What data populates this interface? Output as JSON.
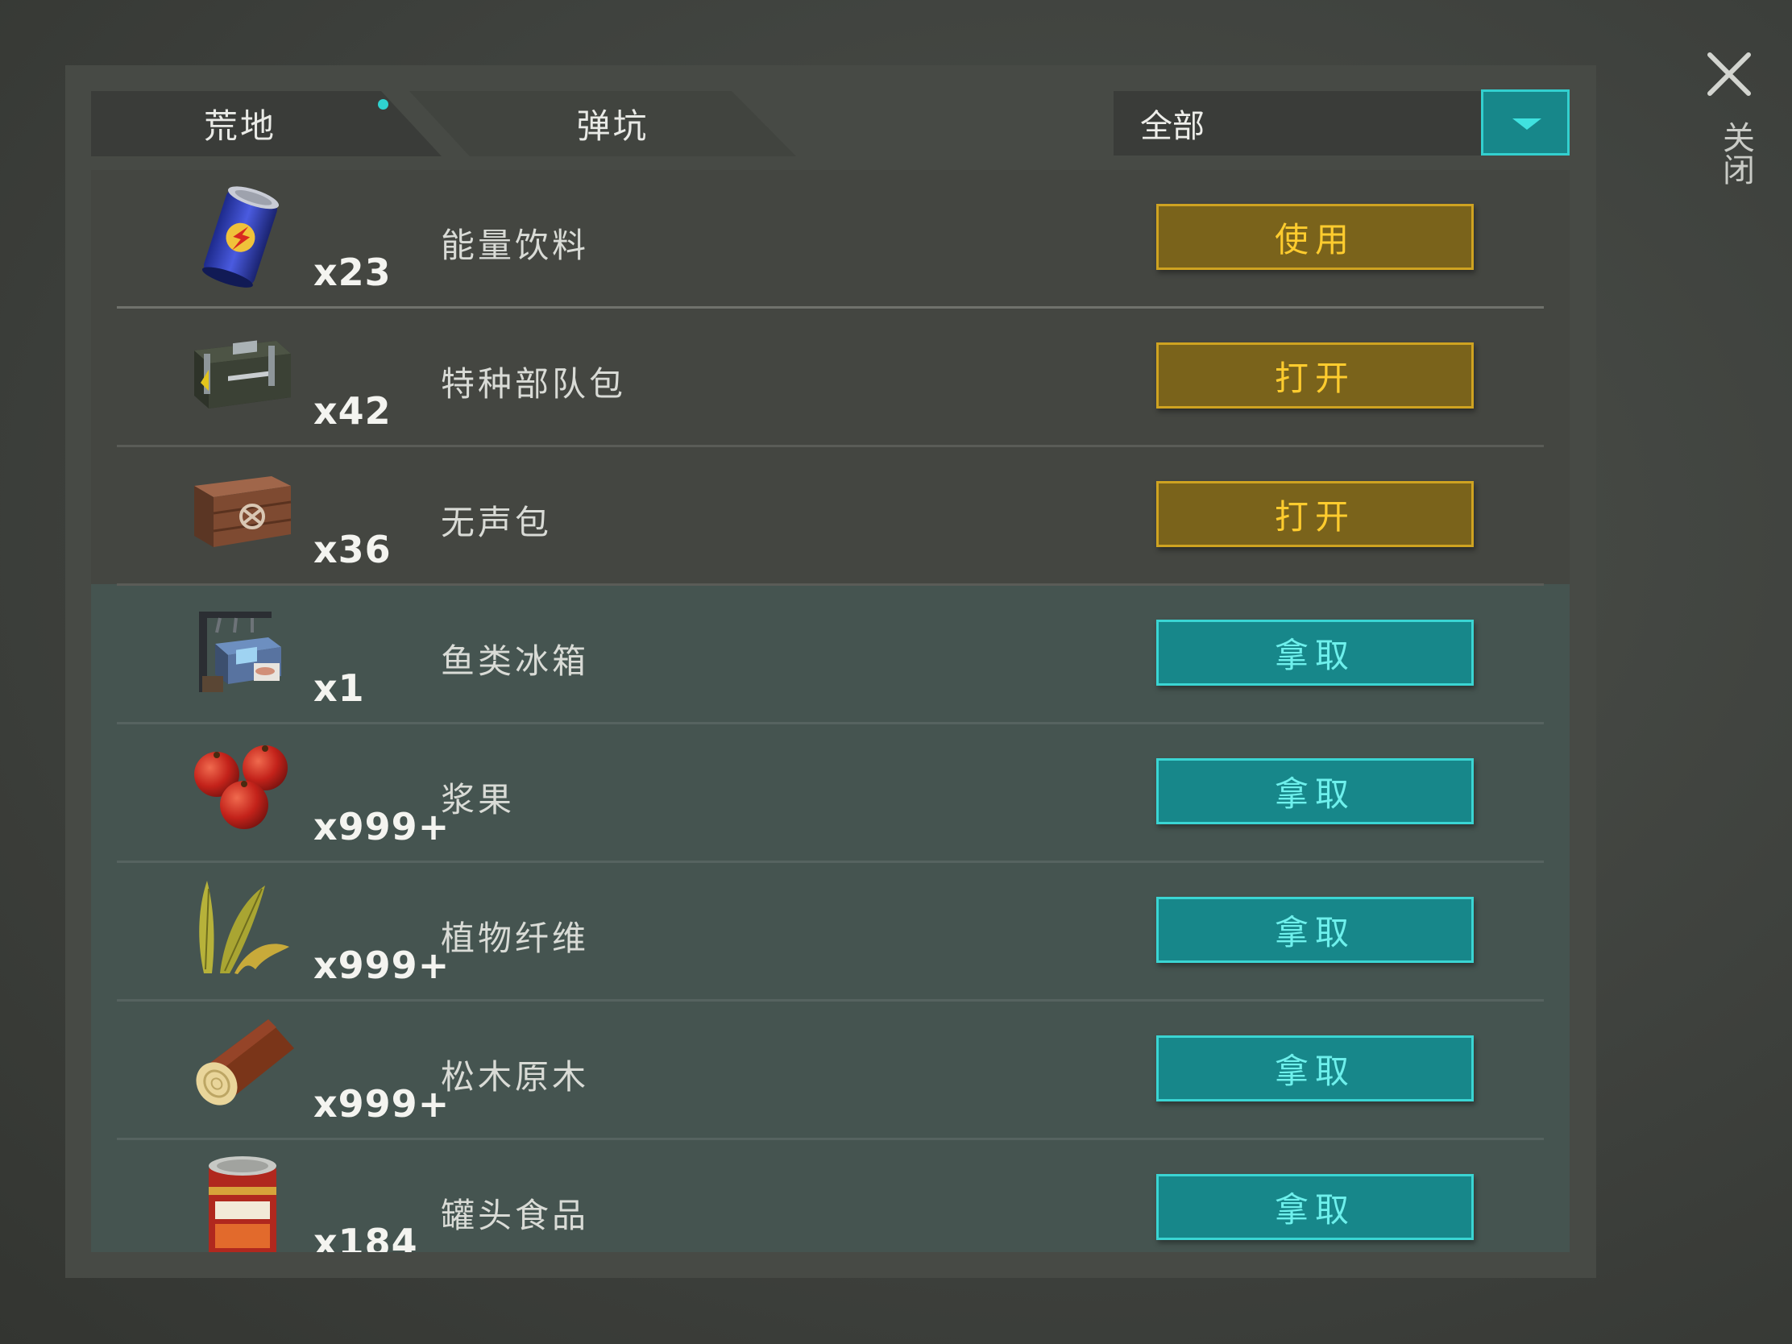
{
  "tabs": [
    {
      "label": "荒地",
      "active": true,
      "has_notification_dot": true
    },
    {
      "label": "弹坑",
      "active": false
    }
  ],
  "filter": {
    "selected": "全部"
  },
  "close_label": "关闭",
  "items": [
    {
      "icon": "energy-drink-can-icon",
      "count": "x23",
      "name": "能量饮料",
      "action": "使用",
      "action_style": "gold"
    },
    {
      "icon": "special-forces-crate-icon",
      "count": "x42",
      "name": "特种部队包",
      "action": "打开",
      "action_style": "gold"
    },
    {
      "icon": "silent-crate-icon",
      "count": "x36",
      "name": "无声包",
      "action": "打开",
      "action_style": "gold"
    },
    {
      "icon": "fish-icebox-icon",
      "count": "x1",
      "name": "鱼类冰箱",
      "action": "拿取",
      "action_style": "teal"
    },
    {
      "icon": "berries-icon",
      "count": "x999+",
      "name": "浆果",
      "action": "拿取",
      "action_style": "teal"
    },
    {
      "icon": "plant-fiber-icon",
      "count": "x999+",
      "name": "植物纤维",
      "action": "拿取",
      "action_style": "teal"
    },
    {
      "icon": "pine-log-icon",
      "count": "x999+",
      "name": "松木原木",
      "action": "拿取",
      "action_style": "teal"
    },
    {
      "icon": "canned-food-icon",
      "count": "x184",
      "name": "罐头食品",
      "action": "拿取",
      "action_style": "teal"
    }
  ],
  "colors": {
    "gold_button_bg": "#7a631b",
    "gold_button_text": "#ffcc2e",
    "teal_button_bg": "#17878a",
    "teal_button_text": "#6ef0ec",
    "accent_cyan": "#2fd2d0"
  }
}
